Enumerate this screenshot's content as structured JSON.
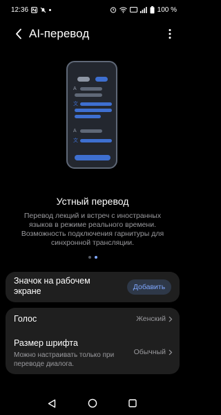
{
  "status_bar": {
    "time": "12:36",
    "battery": "100 %",
    "network_badge": "VoLTE"
  },
  "app_bar": {
    "title": "AI-перевод",
    "back_icon": "back-arrow-icon",
    "more_icon": "more-vertical-icon"
  },
  "hero": {
    "title": "Устный перевод",
    "description": "Перевод лекций и встреч с иностранных языков в режиме реального времени. Возможность подключения гарнитуры для синхронной трансляции.",
    "page_indicator": {
      "count": 2,
      "active": 1
    }
  },
  "illustration": {
    "glyph_a": "A",
    "glyph_zh": "文"
  },
  "settings": {
    "home_icon": {
      "label": "Значок на рабочем экране",
      "button": "Добавить"
    },
    "voice": {
      "label": "Голос",
      "value": "Женский"
    },
    "font_size": {
      "label": "Размер шрифта",
      "sub": "Можно настраивать только при переводе диалога.",
      "value": "Обычный"
    }
  },
  "nav_bar": {
    "back": "nav-back-icon",
    "home": "nav-home-icon",
    "recents": "nav-recents-icon"
  },
  "colors": {
    "background": "#000000",
    "card": "#1f1f1f",
    "accent": "#7fa7ff",
    "accent_bg": "#2e3848",
    "secondary_text": "#9a9a9e",
    "illustration_blue": "#3e6fd0"
  }
}
